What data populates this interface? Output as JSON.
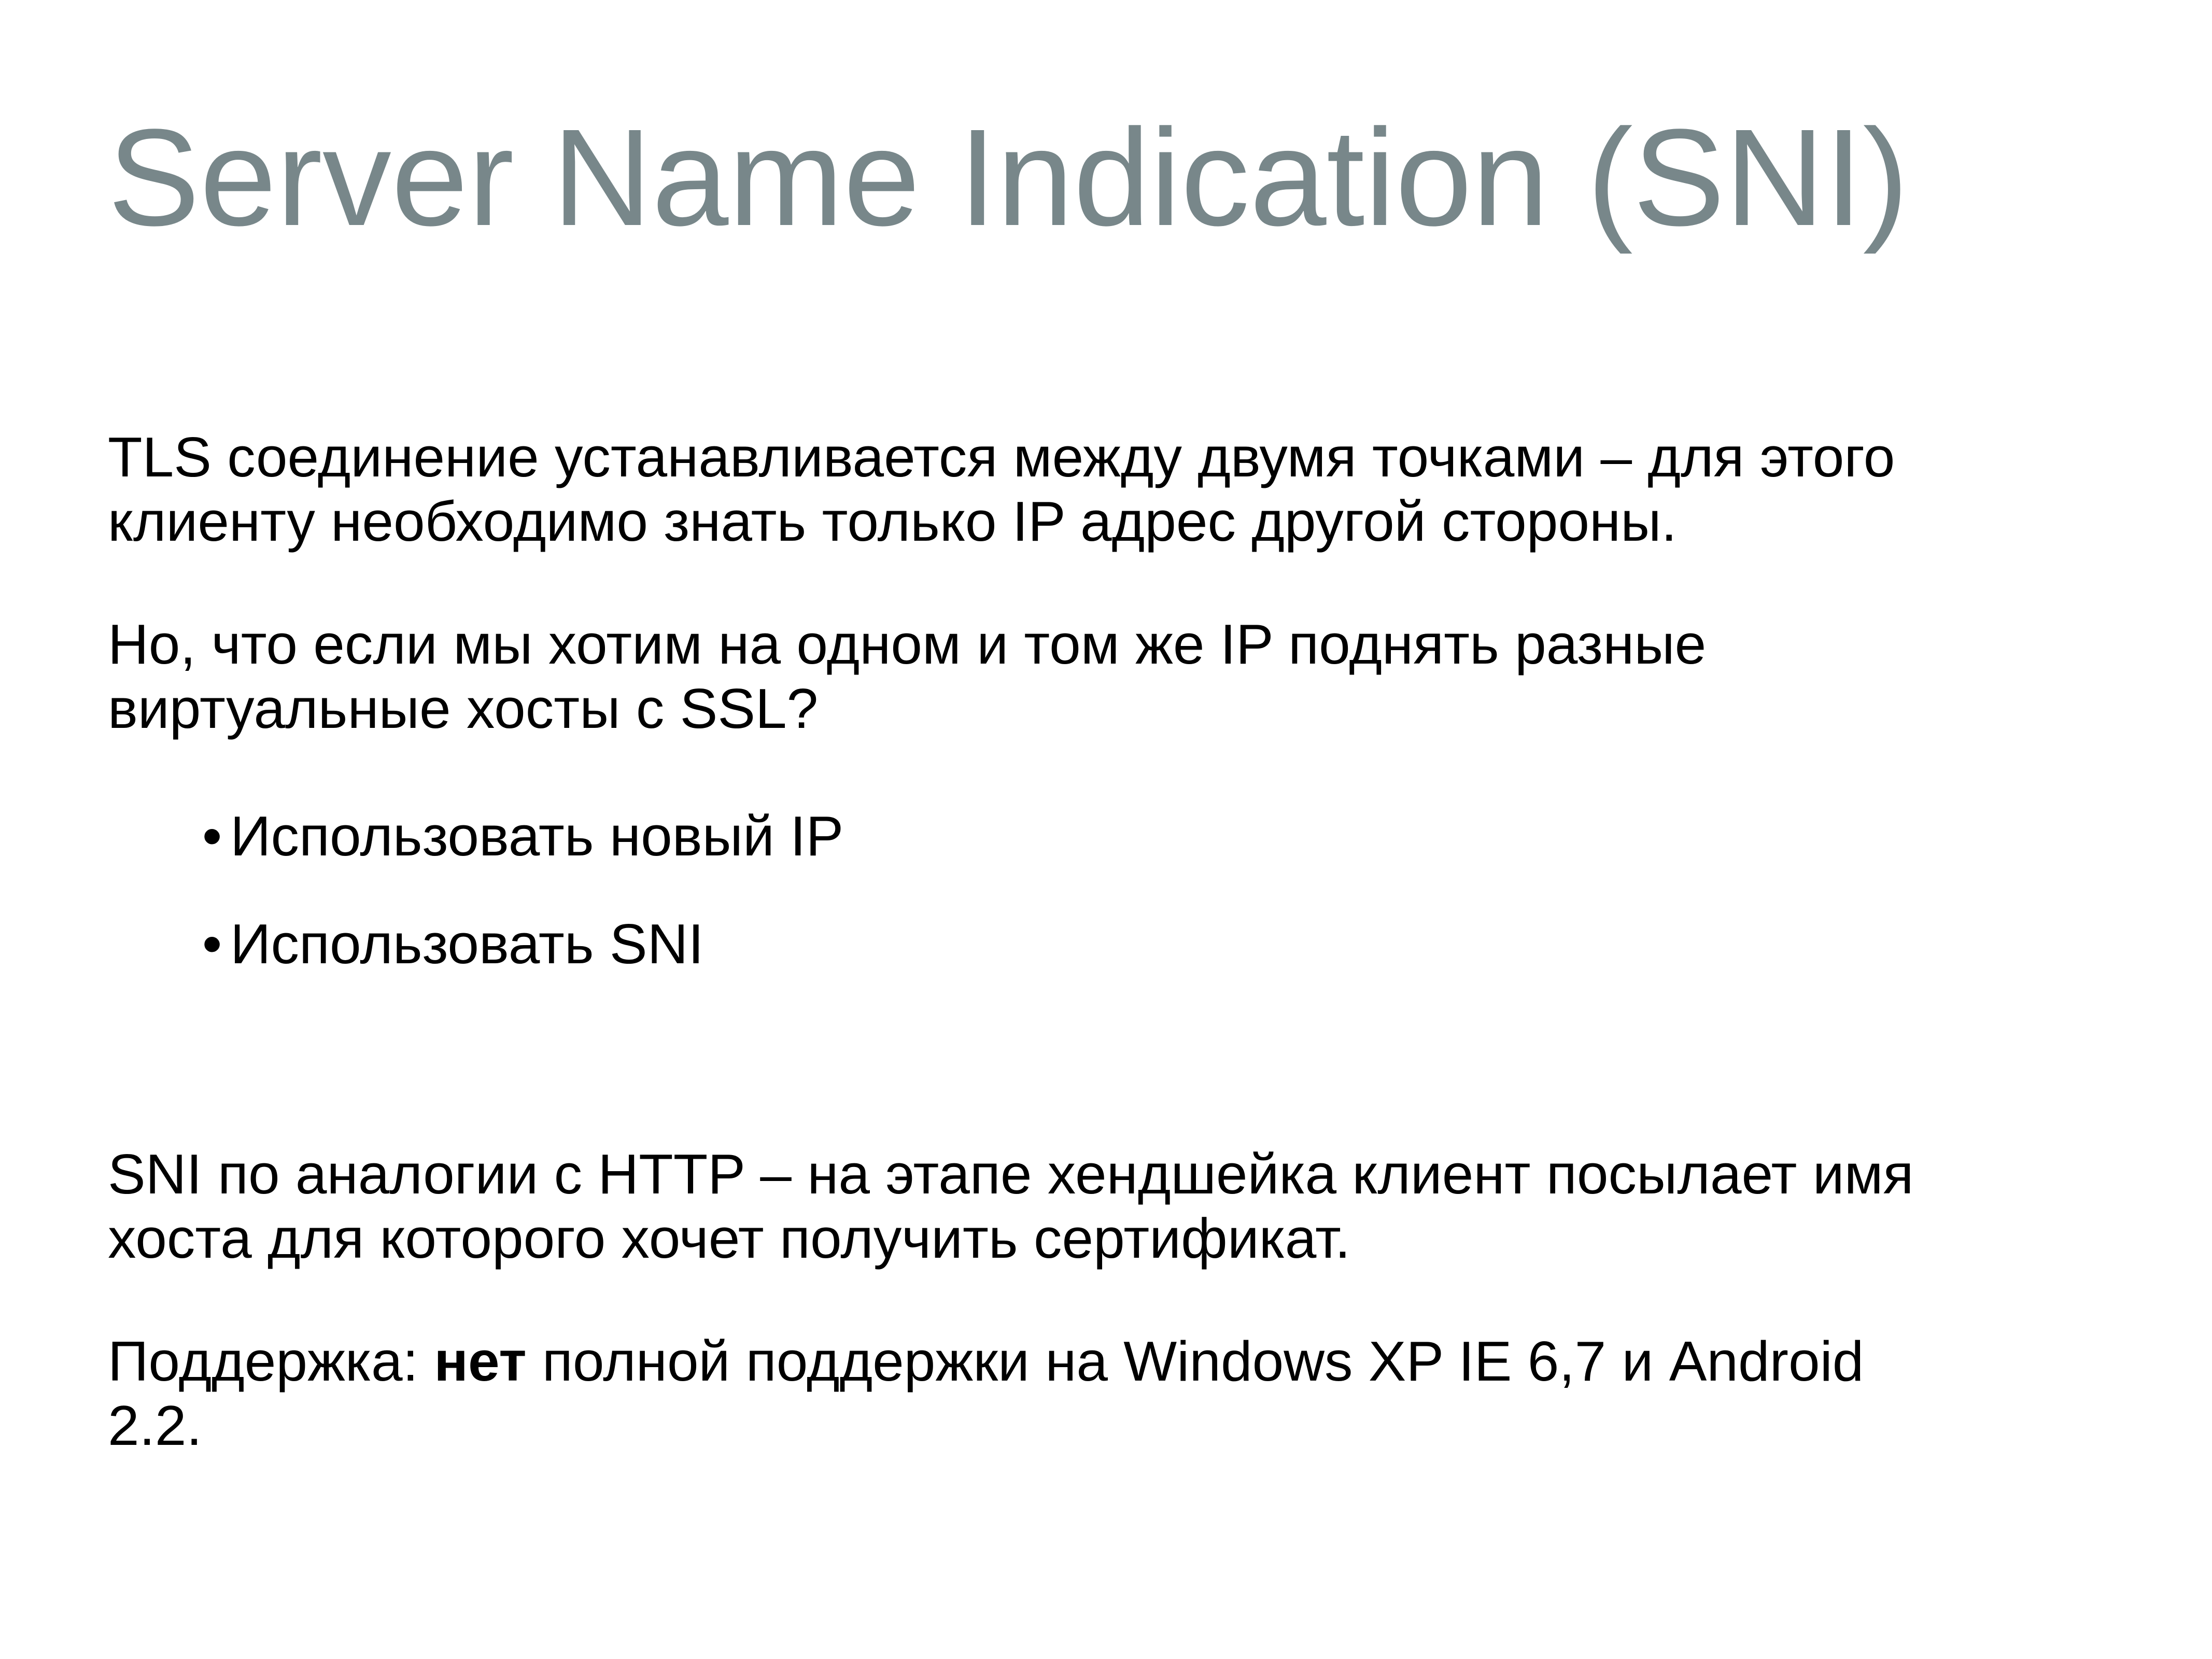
{
  "slide": {
    "title": "Server Name Indication (SNI)",
    "paragraph1": {
      "line1": "TLS соединение устанавливается между двумя точками – для этого",
      "line2": "клиенту необходимо знать только IP адрес другой стороны."
    },
    "paragraph2": {
      "line1": "Но, что если мы хотим на одном и том же IP поднять разные",
      "line2": "виртуальные хосты с SSL?"
    },
    "bullets": [
      {
        "marker": "•",
        "text": "Использовать новый IP"
      },
      {
        "marker": "•",
        "text": "Использовать SNI"
      }
    ],
    "paragraph3": {
      "line1": "SNI по аналогии с HTTP – на этапе хендшейка клиент посылает имя",
      "line2": "хоста  для которого хочет получить сертификат."
    },
    "paragraph4": {
      "prefix": "Поддержка: ",
      "emphasis": "нет",
      "rest": " полной поддержки на Windows XP IE 6,7 и  Android",
      "line2": "2.2."
    }
  },
  "colors": {
    "title": "#78878a",
    "body_text": "#000000",
    "background": "#ffffff"
  }
}
